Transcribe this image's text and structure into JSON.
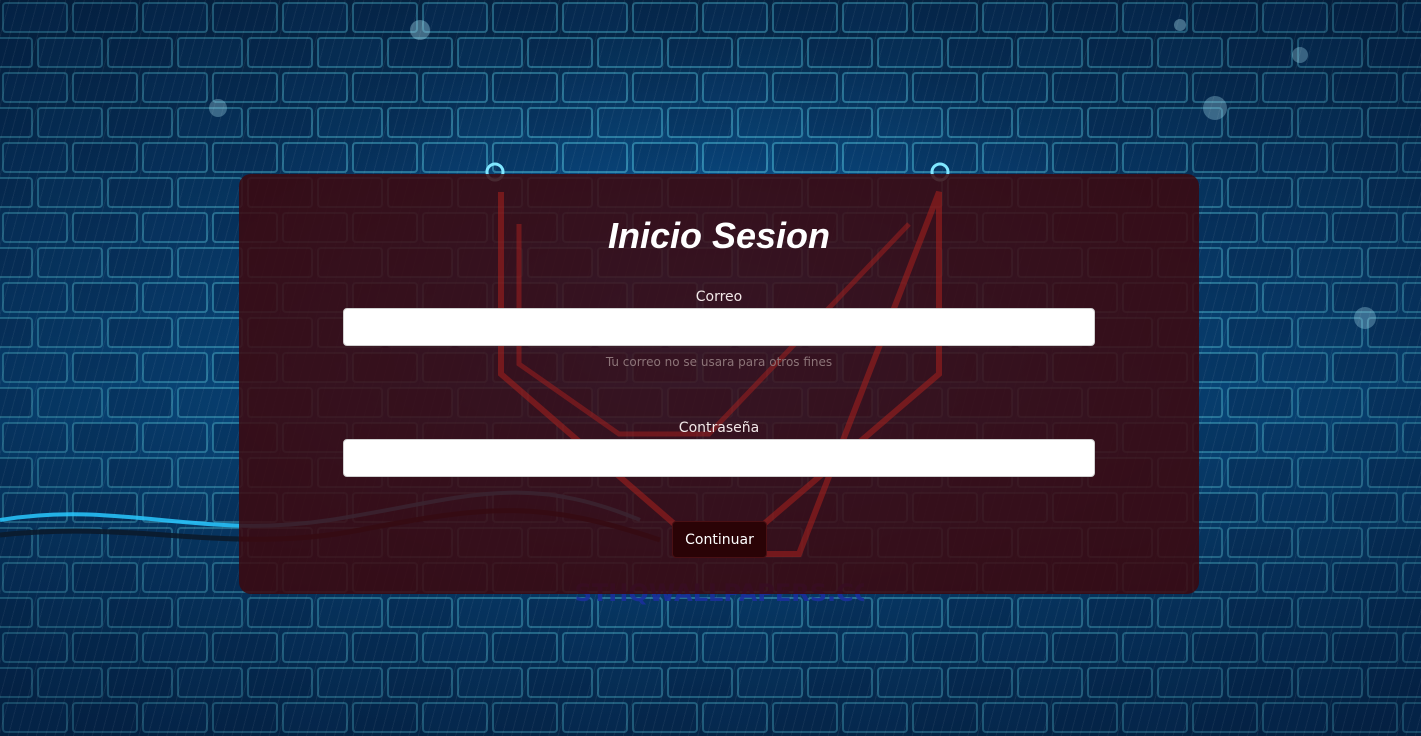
{
  "login": {
    "title": "Inicio Sesion",
    "email_label": "Correo",
    "email_value": "",
    "email_help": "Tu correo no se usara para otros fines",
    "password_label": "Contraseña",
    "password_value": "",
    "submit_label": "Continuar"
  },
  "background": {
    "watermark_text": "BESTHQWALLPAPERS.COM"
  },
  "colors": {
    "card_background": "#3c080e",
    "button_background": "#2a0306",
    "neon_brick": "#29c8ff",
    "neon_logo": "#ff3a3a"
  }
}
